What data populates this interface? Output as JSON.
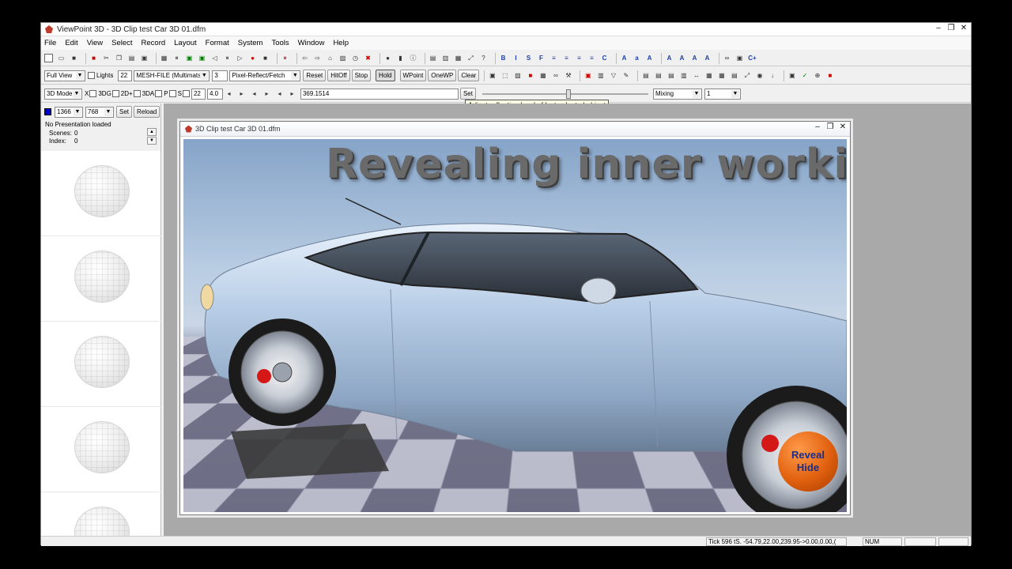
{
  "window": {
    "title": "ViewPoint 3D - 3D Clip test Car 3D 01.dfm",
    "minimize": "–",
    "restore": "❐",
    "close": "✕"
  },
  "menu": [
    "File",
    "Edit",
    "View",
    "Select",
    "Record",
    "Layout",
    "Format",
    "System",
    "Tools",
    "Window",
    "Help"
  ],
  "toolbar2": {
    "view_combo": "Full View",
    "lights_label": "Lights",
    "lights_value": "22",
    "mesh_combo": "MESH-FILE (Multimats",
    "mesh_value": "3",
    "pixel_combo": "Pixel-Reflect/Fetch",
    "reset_btn": "Reset",
    "hitoff_btn": "HitOff",
    "stop_btn": "Stop",
    "hold_btn": "Hold",
    "wpoint_btn": "WPoint",
    "onewp_btn": "OneWP",
    "clear_btn": "Clear"
  },
  "toolbar3": {
    "mode_combo": "3D Mode",
    "x_label": "X",
    "g3_label": "3DG",
    "d2_label": "2D+",
    "a3_label": "3DA",
    "p_label": "P",
    "s_label": "S",
    "val1": "22",
    "val2": "4.0",
    "val3": "369.1514",
    "set_btn": "Set",
    "mixing_combo": "Mixing",
    "mix_value": "1",
    "slider_level": 0.52
  },
  "tooltip": "Adjust reflection level of last selected object",
  "leftpanel": {
    "width_combo": "1366",
    "height_combo": "768",
    "set_btn": "Set",
    "reload_btn": "Reload",
    "presentation": "No Presentation loaded",
    "scenes_label": "Scenes:",
    "scenes_value": "0",
    "index_label": "Index:",
    "index_value": "0",
    "scene_count": 5
  },
  "document": {
    "title": "3D Clip test Car 3D 01.dfm",
    "headline": "Revealing inner workings",
    "reveal_label": "Reveal",
    "hide_label": "Hide"
  },
  "status": {
    "tick": "Tick 596 tS. -54.79,22.00,239.95->0.00,0.00,(",
    "num": "NUM"
  },
  "colors": {
    "brand_icon": "#c0392b",
    "color_box": "#0000cc",
    "reveal_button": "#e0600e",
    "reveal_text": "#1a2d8a"
  }
}
